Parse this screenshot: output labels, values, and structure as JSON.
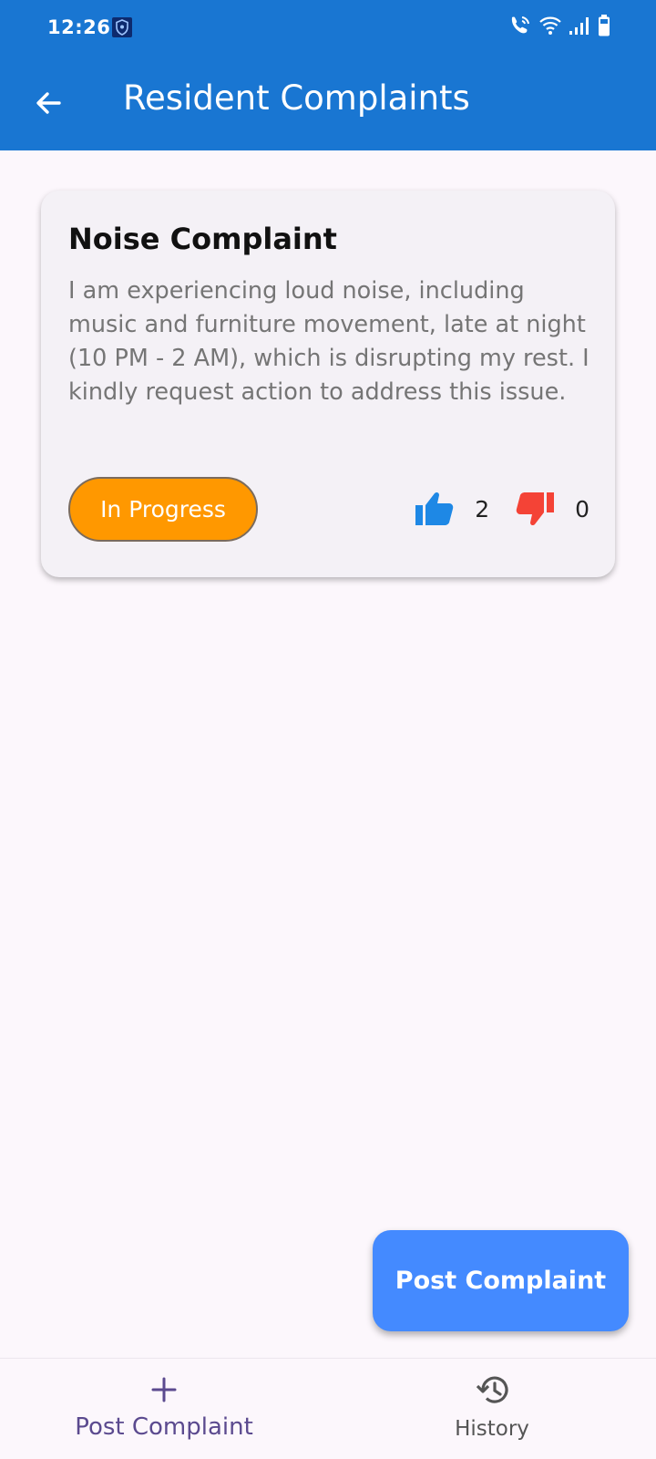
{
  "status_bar": {
    "time": "12:26"
  },
  "app_bar": {
    "title": "Resident Complaints"
  },
  "complaint": {
    "title": "Noise Complaint",
    "description": "I am experiencing loud noise, including music and furniture movement, late at night (10 PM - 2 AM), which is disrupting my rest. I kindly request action to address this issue.",
    "status": "In Progress",
    "upvotes": "2",
    "downvotes": "0"
  },
  "fab": {
    "label": "Post Complaint"
  },
  "bottom_nav": {
    "items": [
      {
        "label": "Post Complaint",
        "icon": "plus-icon",
        "active": true
      },
      {
        "label": "History",
        "icon": "history-icon",
        "active": false
      }
    ]
  },
  "colors": {
    "primary": "#1976d2",
    "status_chip": "#ff9800",
    "upvote": "#1e88e5",
    "downvote": "#f44336",
    "fab": "#448aff",
    "nav_active": "#5b4a8f",
    "background": "#fcf7fc"
  }
}
